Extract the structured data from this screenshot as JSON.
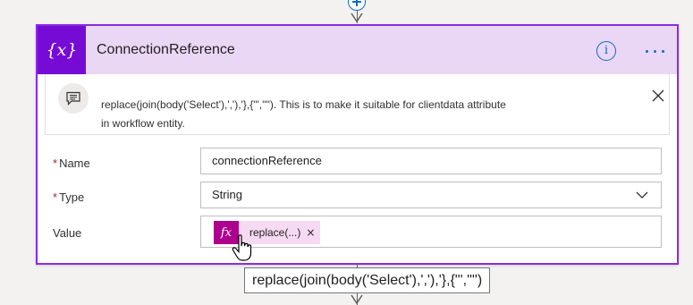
{
  "card": {
    "title": "ConnectionReference",
    "icon": "variable-icon",
    "icon_glyph": "{x}",
    "accent": "#770bd6",
    "border": "#8a2be2",
    "info_glyph": "i"
  },
  "comment": {
    "line1": "replace(join(body('Select'),','),'},{\"','\"'). This is to make it suitable for clientdata attribute",
    "line2": "in workflow entity."
  },
  "fields": {
    "name": {
      "label": "Name",
      "required": "*",
      "value": "connectionReference"
    },
    "type": {
      "label": "Type",
      "required": "*",
      "value": "String"
    },
    "value": {
      "label": "Value",
      "token": {
        "icon_glyph": "fx",
        "label": "replace(...)",
        "remove": "×",
        "color": "#ad008c"
      }
    }
  },
  "tooltip": {
    "text": "replace(join(body('Select'),','),'},{\"','\"')"
  }
}
